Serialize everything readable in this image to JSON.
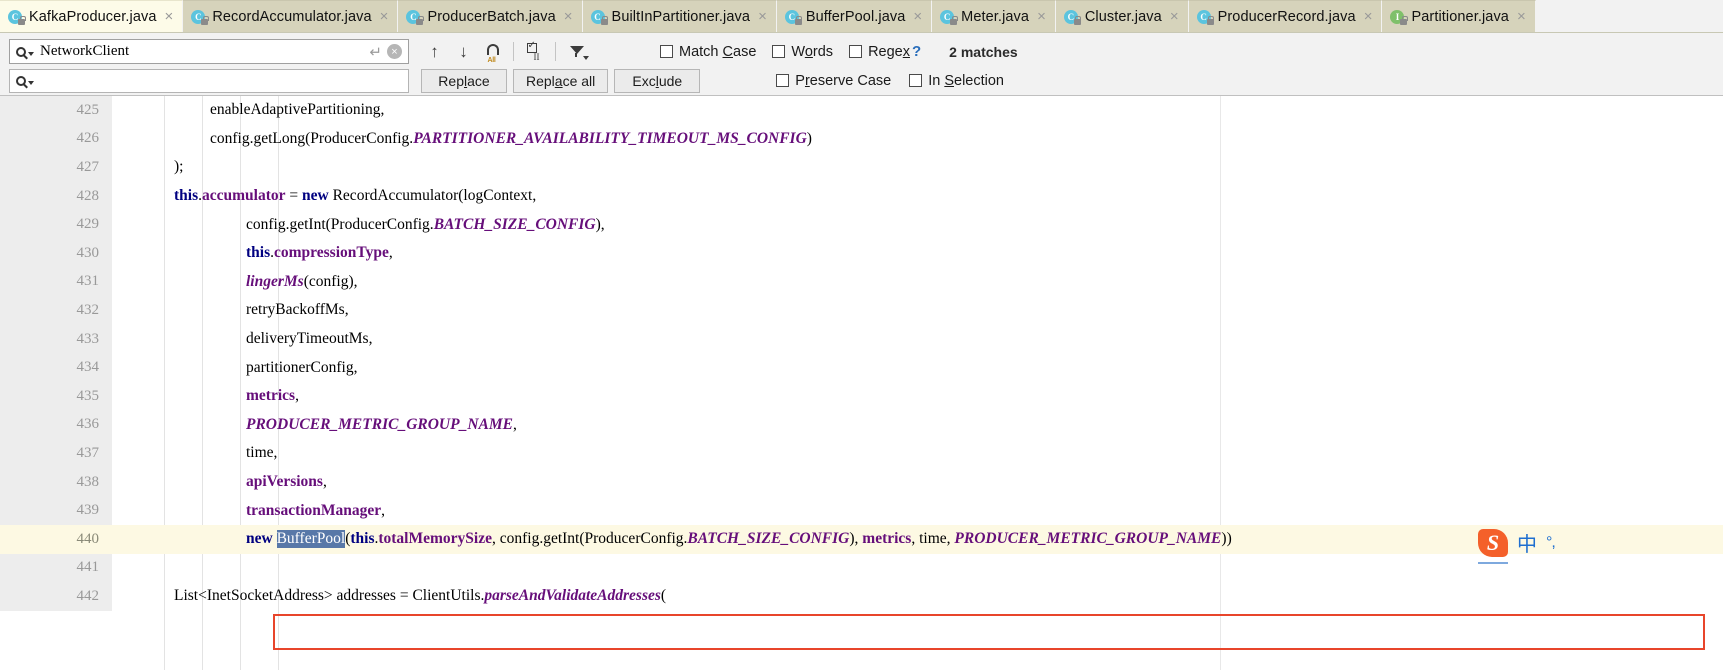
{
  "tabs": [
    {
      "label": "KafkaProducer.java",
      "icon": "class-icon",
      "active": true
    },
    {
      "label": "RecordAccumulator.java",
      "icon": "class-icon",
      "active": false
    },
    {
      "label": "ProducerBatch.java",
      "icon": "class-icon",
      "active": false
    },
    {
      "label": "BuiltInPartitioner.java",
      "icon": "class-icon",
      "active": false
    },
    {
      "label": "BufferPool.java",
      "icon": "class-icon",
      "active": false
    },
    {
      "label": "Meter.java",
      "icon": "class-icon",
      "active": false
    },
    {
      "label": "Cluster.java",
      "icon": "class-icon",
      "active": false
    },
    {
      "label": "ProducerRecord.java",
      "icon": "class-icon",
      "active": false
    },
    {
      "label": "Partitioner.java",
      "icon": "interface-icon",
      "active": false
    }
  ],
  "tab_close_glyph": "×",
  "find": {
    "search_value": "NetworkClient",
    "search_placeholder": "",
    "replace_value": "",
    "replace_placeholder": "",
    "enter_glyph": "↵",
    "clear_glyph": "×",
    "prev_glyph": "↑",
    "next_glyph": "↓",
    "select_all_label": "All",
    "buttons": [
      {
        "label": "Replace",
        "mnemonic": "l"
      },
      {
        "label": "Replace all",
        "mnemonic": "a"
      },
      {
        "label": "Exclude",
        "mnemonic": "l"
      }
    ],
    "checkboxes_row1": [
      {
        "label": "Match Case",
        "mnemonic": "C",
        "checked": false
      },
      {
        "label": "Words",
        "mnemonic": "o",
        "checked": false
      },
      {
        "label": "Regex",
        "mnemonic": "x",
        "checked": false
      }
    ],
    "checkboxes_row2": [
      {
        "label": "Preserve Case",
        "mnemonic": "r",
        "checked": false
      },
      {
        "label": "In Selection",
        "mnemonic": "S",
        "checked": false
      }
    ],
    "help_glyph": "?",
    "match_count": "2 matches"
  },
  "editor": {
    "lines": [
      {
        "number": "425",
        "highlighted": false,
        "indent": 36,
        "tokens": [
          {
            "t": "enableAdaptivePartitioning,",
            "c": "pln"
          }
        ]
      },
      {
        "number": "426",
        "highlighted": false,
        "indent": 36,
        "tokens": [
          {
            "t": "config.getLong(ProducerConfig.",
            "c": "pln"
          },
          {
            "t": "PARTITIONER_AVAILABILITY_TIMEOUT_MS_CONFIG",
            "c": "stc"
          },
          {
            "t": ")",
            "c": "pln"
          }
        ]
      },
      {
        "number": "427",
        "highlighted": false,
        "indent": 0,
        "tokens": [
          {
            "t": ");",
            "c": "pln"
          }
        ]
      },
      {
        "number": "428",
        "highlighted": false,
        "indent": 0,
        "tokens": [
          {
            "t": "this",
            "c": "kw"
          },
          {
            "t": ".",
            "c": "pln"
          },
          {
            "t": "accumulator",
            "c": "fld"
          },
          {
            "t": " = ",
            "c": "pln"
          },
          {
            "t": "new",
            "c": "kw"
          },
          {
            "t": " RecordAccumulator(logContext,",
            "c": "pln"
          }
        ]
      },
      {
        "number": "429",
        "highlighted": false,
        "indent": 72,
        "tokens": [
          {
            "t": "config.getInt(ProducerConfig.",
            "c": "pln"
          },
          {
            "t": "BATCH_SIZE_CONFIG",
            "c": "stc"
          },
          {
            "t": "),",
            "c": "pln"
          }
        ]
      },
      {
        "number": "430",
        "highlighted": false,
        "indent": 72,
        "tokens": [
          {
            "t": "this",
            "c": "kw"
          },
          {
            "t": ".",
            "c": "pln"
          },
          {
            "t": "compressionType",
            "c": "fld"
          },
          {
            "t": ",",
            "c": "pln"
          }
        ]
      },
      {
        "number": "431",
        "highlighted": false,
        "indent": 72,
        "tokens": [
          {
            "t": "lingerMs",
            "c": "stc"
          },
          {
            "t": "(config),",
            "c": "pln"
          }
        ]
      },
      {
        "number": "432",
        "highlighted": false,
        "indent": 72,
        "tokens": [
          {
            "t": "retryBackoffMs,",
            "c": "pln"
          }
        ]
      },
      {
        "number": "433",
        "highlighted": false,
        "indent": 72,
        "tokens": [
          {
            "t": "deliveryTimeoutMs,",
            "c": "pln"
          }
        ]
      },
      {
        "number": "434",
        "highlighted": false,
        "indent": 72,
        "tokens": [
          {
            "t": "partitionerConfig,",
            "c": "pln"
          }
        ]
      },
      {
        "number": "435",
        "highlighted": false,
        "indent": 72,
        "tokens": [
          {
            "t": "metrics",
            "c": "fld"
          },
          {
            "t": ",",
            "c": "pln"
          }
        ]
      },
      {
        "number": "436",
        "highlighted": false,
        "indent": 72,
        "tokens": [
          {
            "t": "PRODUCER_METRIC_GROUP_NAME",
            "c": "stc"
          },
          {
            "t": ",",
            "c": "pln"
          }
        ]
      },
      {
        "number": "437",
        "highlighted": false,
        "indent": 72,
        "tokens": [
          {
            "t": "time,",
            "c": "pln"
          }
        ]
      },
      {
        "number": "438",
        "highlighted": false,
        "indent": 72,
        "tokens": [
          {
            "t": "apiVersions",
            "c": "fld"
          },
          {
            "t": ",",
            "c": "pln"
          }
        ]
      },
      {
        "number": "439",
        "highlighted": false,
        "indent": 72,
        "tokens": [
          {
            "t": "transactionManager",
            "c": "fld"
          },
          {
            "t": ",",
            "c": "pln"
          }
        ]
      },
      {
        "number": "440",
        "highlighted": true,
        "indent": 72,
        "tokens": [
          {
            "t": "new",
            "c": "kw"
          },
          {
            "t": " ",
            "c": "pln"
          },
          {
            "t": "BufferPool",
            "c": "sel"
          },
          {
            "t": "(",
            "c": "pln"
          },
          {
            "t": "this",
            "c": "kw"
          },
          {
            "t": ".",
            "c": "pln"
          },
          {
            "t": "totalMemorySize",
            "c": "fld"
          },
          {
            "t": ", config.getInt(ProducerConfig.",
            "c": "pln"
          },
          {
            "t": "BATCH_SIZE_CONFIG",
            "c": "stc"
          },
          {
            "t": "), ",
            "c": "pln"
          },
          {
            "t": "metrics",
            "c": "fld"
          },
          {
            "t": ", time, ",
            "c": "pln"
          },
          {
            "t": "PRODUCER_METRIC_GROUP_NAME",
            "c": "stc"
          },
          {
            "t": "))",
            "c": "pln"
          }
        ]
      },
      {
        "number": "441",
        "highlighted": false,
        "indent": 0,
        "tokens": [
          {
            "t": "",
            "c": "pln"
          }
        ]
      },
      {
        "number": "442",
        "highlighted": false,
        "indent": 0,
        "tokens": [
          {
            "t": "List<InetSocketAddress> addresses = ClientUtils.",
            "c": "pln"
          },
          {
            "t": "parseAndValidateAddresses",
            "c": "stc"
          },
          {
            "t": "(",
            "c": "pln"
          }
        ]
      }
    ]
  },
  "ime": {
    "logo": "S",
    "mode": "中",
    "punct": "°,"
  },
  "colors": {
    "tab_active_bg": "#fdfbe8",
    "tab_bg": "#d6d3bb",
    "panel_bg": "#f2f2f2",
    "keyword": "#000080",
    "field": "#660e7a",
    "static_const": "#660e7a",
    "selection": "#5878a8",
    "highlight_line": "#fdf9e3",
    "annotation_red": "#e8452b",
    "help_blue": "#2a6ebb"
  }
}
